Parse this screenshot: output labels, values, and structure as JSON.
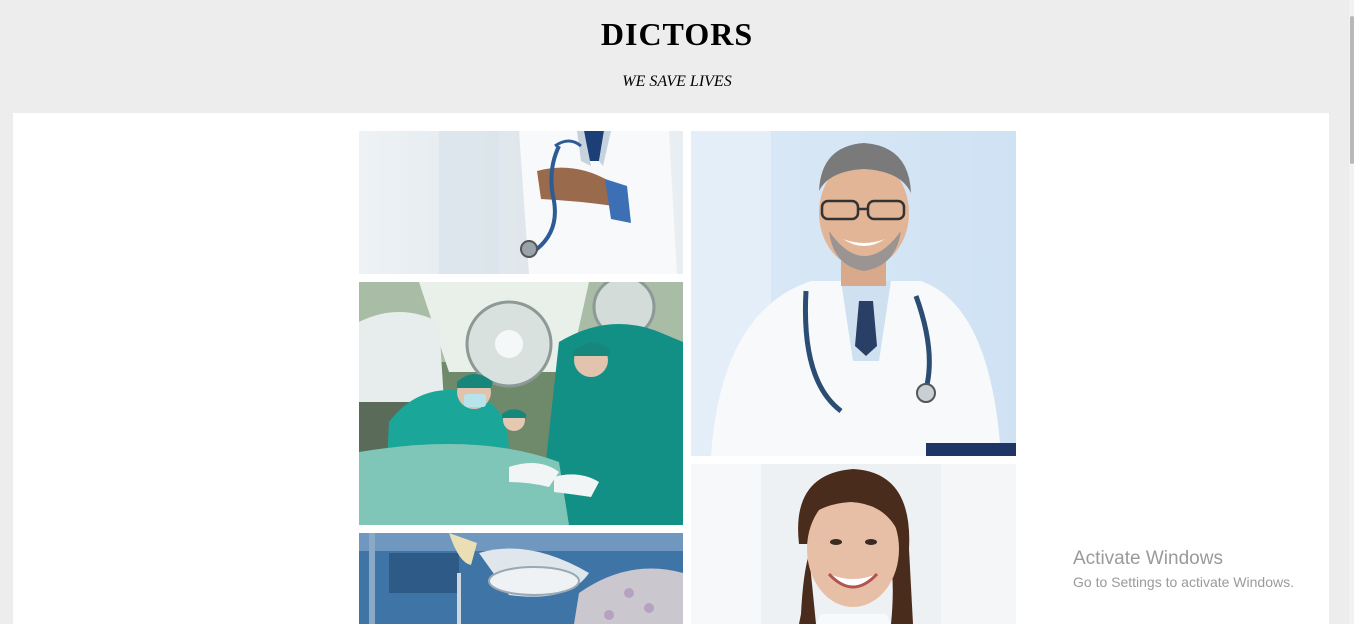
{
  "header": {
    "title": "DICTORS",
    "tagline": "WE SAVE LIVES"
  },
  "gallery": {
    "images": [
      {
        "subject": "doctor-arms-crossed-stethoscope"
      },
      {
        "subject": "surgical-team-operating-room"
      },
      {
        "subject": "operating-room-equipment"
      },
      {
        "subject": "smiling-male-doctor-portrait"
      },
      {
        "subject": "smiling-female-doctor-portrait"
      }
    ]
  },
  "watermark": {
    "title": "Activate Windows",
    "subtitle": "Go to Settings to activate Windows."
  },
  "colors": {
    "page_background": "#ededed",
    "content_background": "#ffffff",
    "watermark_text": "#9a9a9a"
  }
}
